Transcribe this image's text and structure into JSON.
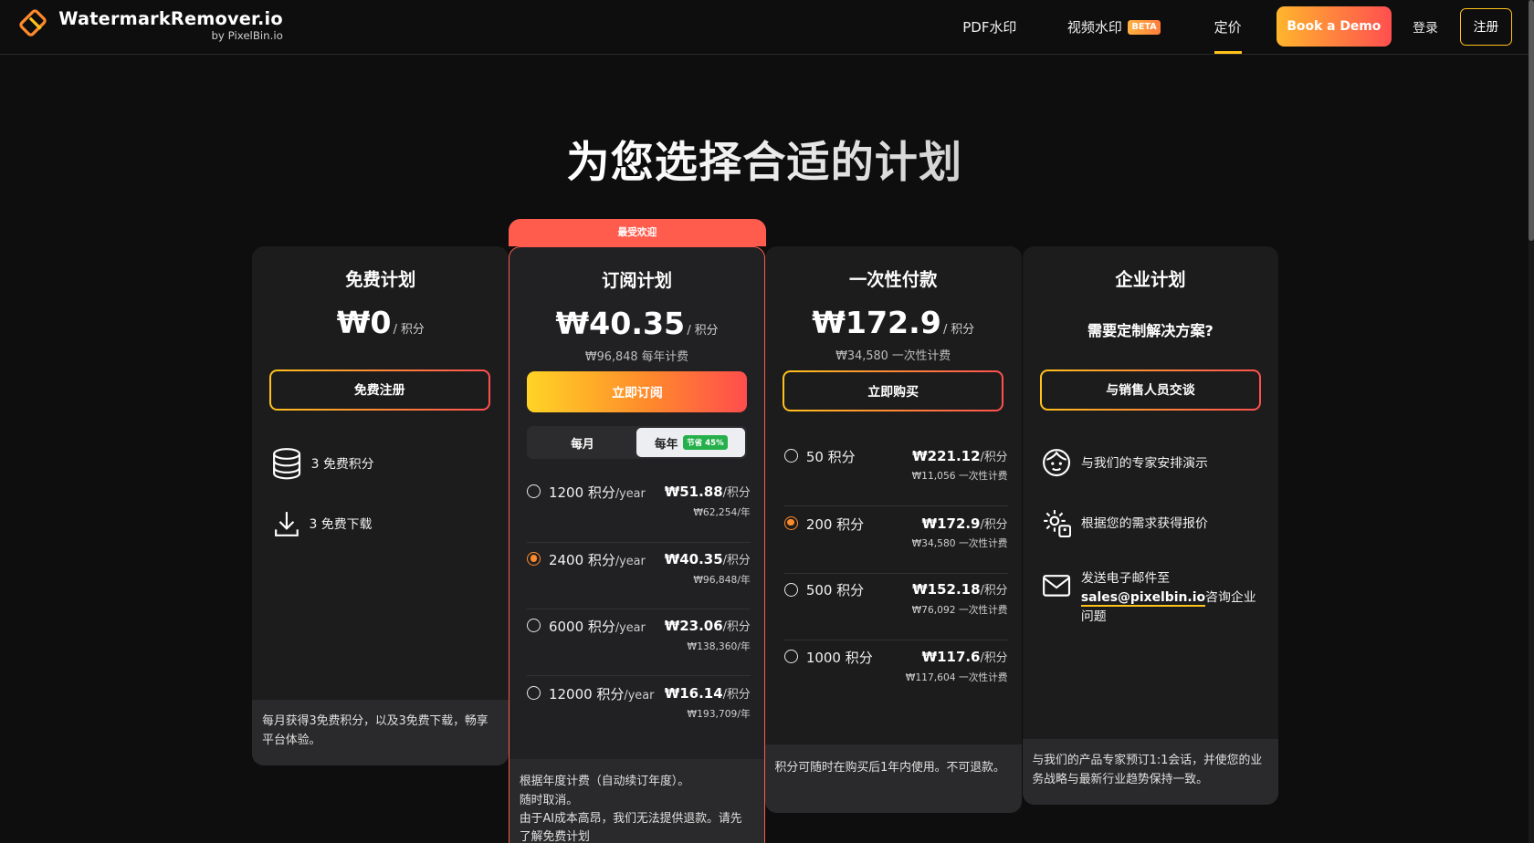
{
  "header": {
    "logo_title": "WatermarkRemover.io",
    "logo_sub": "by PixelBin.io",
    "nav": {
      "pdf": "PDF水印",
      "video": "视频水印",
      "beta": "BETA",
      "pricing": "定价"
    },
    "book_demo": "Book a Demo",
    "login": "登录",
    "signup": "注册"
  },
  "page_title": "为您选择合适的计划",
  "free": {
    "title": "免费计划",
    "price": "₩0",
    "per": "/ 积分",
    "cta": "免费注册",
    "features": [
      "3 免费积分",
      "3 免费下载"
    ],
    "footer": "每月获得3免费积分，以及3免费下载，畅享平台体验。"
  },
  "subscription": {
    "badge": "最受欢迎",
    "title": "订阅计划",
    "price": "₩40.35",
    "per": "/ 积分",
    "subprice": "₩96,848 每年计费",
    "cta": "立即订阅",
    "toggle_monthly": "每月",
    "toggle_yearly": "每年",
    "save_badge": "节省 45%",
    "plans": [
      {
        "credits": "1200 积分",
        "unit": "/year",
        "price": "₩51.88",
        "per": "/积分",
        "total": "₩62,254/年",
        "selected": false
      },
      {
        "credits": "2400 积分",
        "unit": "/year",
        "price": "₩40.35",
        "per": "/积分",
        "total": "₩96,848/年",
        "selected": true
      },
      {
        "credits": "6000 积分",
        "unit": "/year",
        "price": "₩23.06",
        "per": "/积分",
        "total": "₩138,360/年",
        "selected": false
      },
      {
        "credits": "12000 积分",
        "unit": "/year",
        "price": "₩16.14",
        "per": "/积分",
        "total": "₩193,709/年",
        "selected": false
      }
    ],
    "footer_lines": [
      "根据年度计费（自动续订年度）。",
      "随时取消。",
      "由于AI成本高昂，我们无法提供退款。请先",
      "了解免费计划"
    ]
  },
  "onetime": {
    "title": "一次性付款",
    "price": "₩172.9",
    "per": "/ 积分",
    "subprice": "₩34,580 一次性计费",
    "cta": "立即购买",
    "plans": [
      {
        "credits": "50 积分",
        "price": "₩221.12",
        "per": "/积分",
        "total": "₩11,056 一次性计费",
        "selected": false
      },
      {
        "credits": "200 积分",
        "price": "₩172.9",
        "per": "/积分",
        "total": "₩34,580 一次性计费",
        "selected": true
      },
      {
        "credits": "500 积分",
        "price": "₩152.18",
        "per": "/积分",
        "total": "₩76,092 一次性计费",
        "selected": false
      },
      {
        "credits": "1000 积分",
        "price": "₩117.6",
        "per": "/积分",
        "total": "₩117,604 一次性计费",
        "selected": false
      }
    ],
    "footer": "积分可随时在购买后1年内使用。不可退款。"
  },
  "enterprise": {
    "title": "企业计划",
    "subtitle": "需要定制解决方案?",
    "cta": "与销售人员交谈",
    "feature_demo": "与我们的专家安排演示",
    "feature_quote": "根据您的需求获得报价",
    "mail_prefix": "发送电子邮件至",
    "mail_address": "sales@pixelbin.io",
    "mail_suffix": "咨询企业问题",
    "footer": "与我们的产品专家预订1:1会话，并使您的业务战略与最新行业趋势保持一致。"
  },
  "colors": {
    "accent_yellow": "#ffc21a",
    "accent_red": "#ff5c4d",
    "save_green": "#25b04b"
  }
}
